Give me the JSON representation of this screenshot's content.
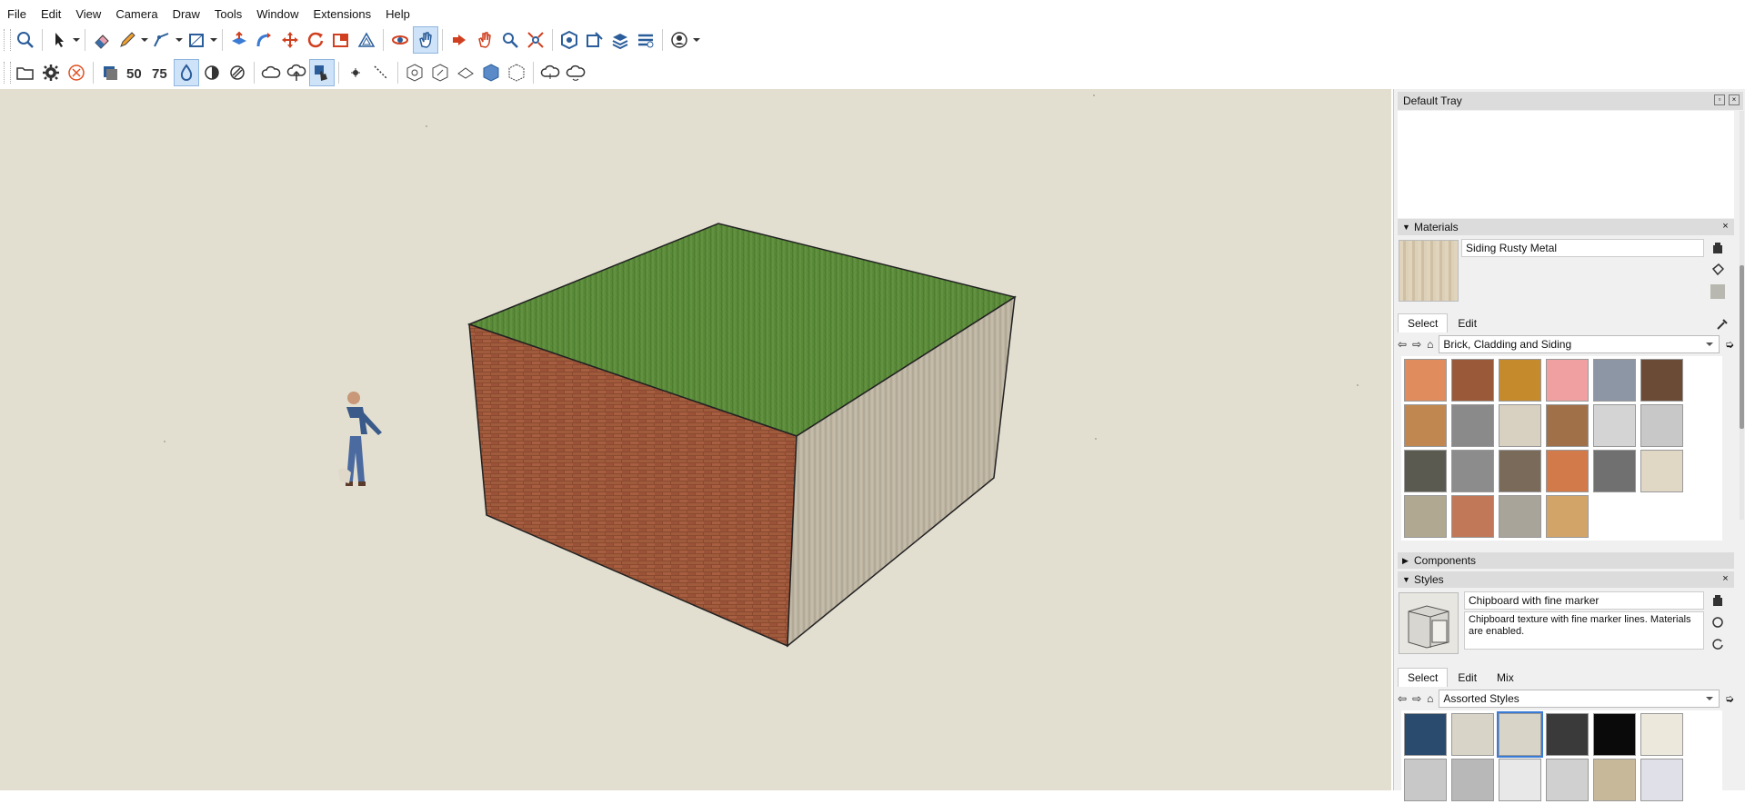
{
  "menu": [
    "File",
    "Edit",
    "View",
    "Camera",
    "Draw",
    "Tools",
    "Window",
    "Extensions",
    "Help"
  ],
  "toolbar1": [
    "zoom-extents-icon",
    "select-icon",
    "eraser-icon",
    "pencil-icon",
    "line-icon",
    "rectangle-icon",
    "push-pull-icon",
    "follow-me-icon",
    "move-icon",
    "rotate-icon",
    "scale-icon",
    "offset-icon",
    "orbit-icon",
    "pan-icon",
    "walk-icon",
    "zoom-icon",
    "zoom-window-icon",
    "warehouse-icon",
    "extension-warehouse-icon",
    "layers-icon",
    "styles-icon",
    "account-icon"
  ],
  "toolbar2": [
    "open-icon",
    "settings-icon",
    "cancel-icon",
    "stack-icon",
    "50-icon",
    "75-icon",
    "drop-icon",
    "contrast-icon",
    "stripes-icon",
    "cloud-x-icon",
    "cloud-upload-icon",
    "tap-icon",
    "point-icon",
    "dotted-line-icon",
    "view-1-icon",
    "view-2-icon",
    "view-3-icon",
    "view-4-icon",
    "view-5-icon",
    "cloud-a-icon",
    "cloud-b-icon"
  ],
  "tray": {
    "title": "Default Tray",
    "materials": {
      "header": "Materials",
      "current_name": "Siding Rusty Metal",
      "tabs": [
        "Select",
        "Edit"
      ],
      "library": "Brick, Cladding and Siding",
      "swatch_colors": [
        "#e08c5c",
        "#9a5a3a",
        "#c48a2c",
        "#f0a0a0",
        "#8c96a4",
        "#6b4a36",
        "#c08850",
        "#8a8a8a",
        "#d8d0c0",
        "#a07048",
        "#d4d4d4",
        "#c8c8c8",
        "#5a5a50",
        "#8c8c8c",
        "#7a6a5a",
        "#d27a4a",
        "#707070",
        "#e0d8c4",
        "#b0a890",
        "#c07858",
        "#a8a49a",
        "#d2a468"
      ]
    },
    "components": {
      "header": "Components"
    },
    "styles": {
      "header": "Styles",
      "current_name": "Chipboard with fine marker",
      "description": "Chipboard texture with fine marker lines. Materials are enabled.",
      "tabs": [
        "Select",
        "Edit",
        "Mix"
      ],
      "library": "Assorted Styles",
      "swatch_colors": [
        "#2a4a6e",
        "#d8d4c8",
        "#d8d4c8",
        "#3a3a3a",
        "#0a0a0a",
        "#ece8dc",
        "#c8c8c8",
        "#b8b8b8",
        "#e8e8e8",
        "#d0d0d0",
        "#c8b89a",
        "#e0e0e8"
      ]
    }
  },
  "colors": {
    "viewport": "#e2dfd1",
    "accent": "#3a7bd5"
  }
}
